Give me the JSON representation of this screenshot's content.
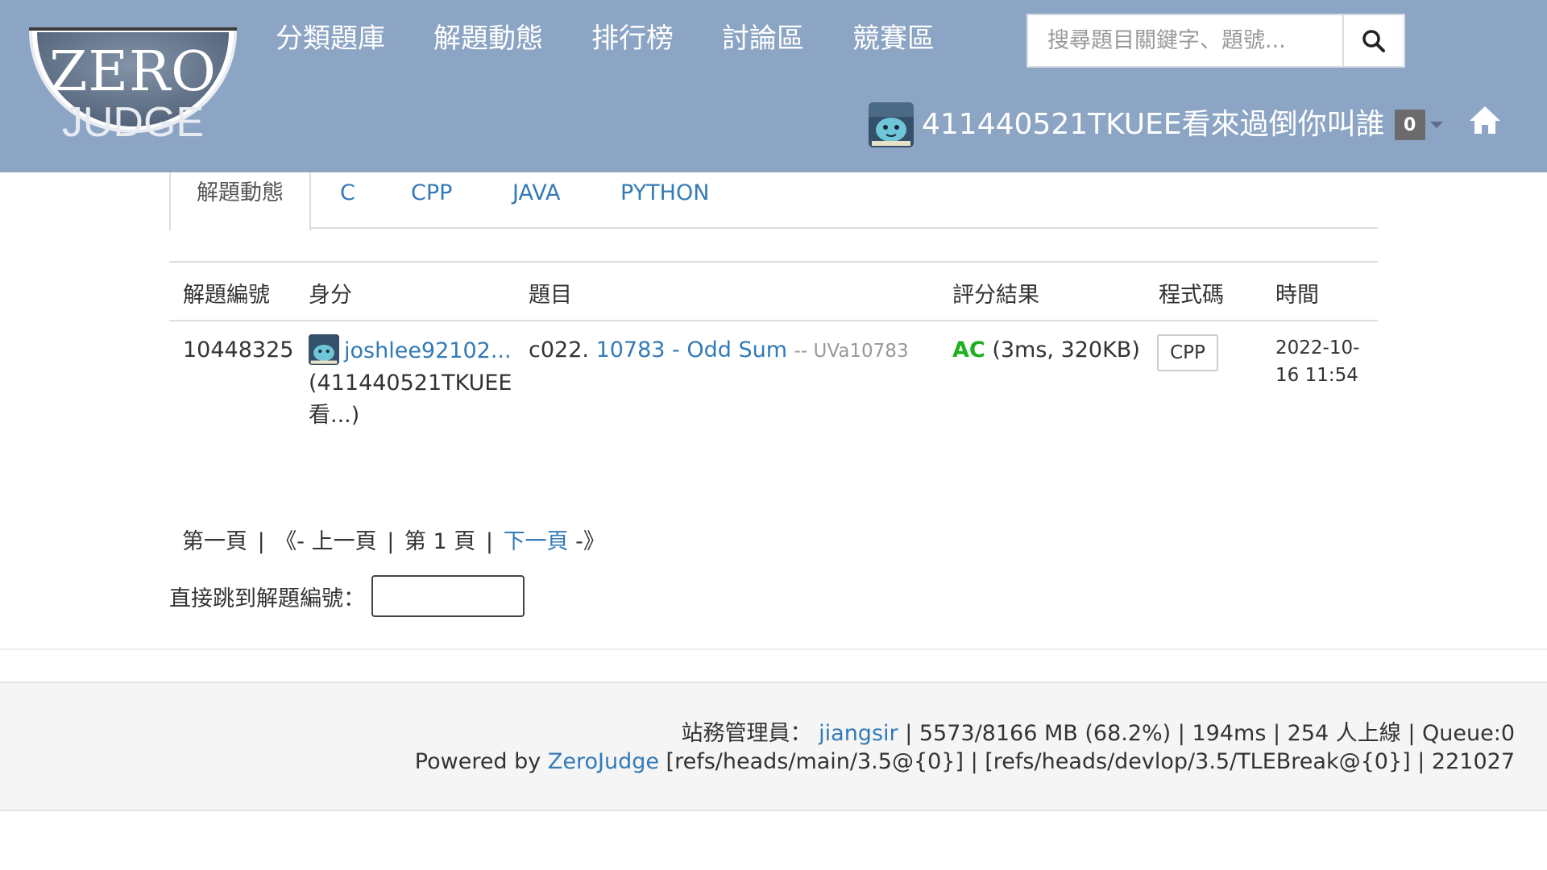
{
  "logo": {
    "line1": "ZERO",
    "line2": "JUDGE"
  },
  "nav": {
    "items": [
      "分類題庫",
      "解題動態",
      "排行榜",
      "討論區",
      "競賽區"
    ]
  },
  "search": {
    "placeholder": "搜尋題目關鍵字、題號..."
  },
  "user": {
    "name": "411440521TKUEE看來過倒你叫誰",
    "badge": "0"
  },
  "tabs": {
    "active": "解題動態",
    "items": [
      "C",
      "CPP",
      "JAVA",
      "PYTHON"
    ]
  },
  "table": {
    "headers": {
      "id": "解題編號",
      "identity": "身分",
      "problem": "題目",
      "result": "評分結果",
      "code": "程式碼",
      "time": "時間"
    },
    "rows": [
      {
        "id": "10448325",
        "username": "joshlee92102...",
        "identity_line1": "(411440521TKUEE",
        "identity_line2": "看...)",
        "problem_code": "c022.",
        "problem_title": "10783 - Odd Sum",
        "problem_source": "-- UVa10783",
        "result_status": "AC",
        "result_detail": "(3ms, 320KB)",
        "code_lang": "CPP",
        "time_line1": "2022-10-",
        "time_line2": "16 11:54"
      }
    ]
  },
  "pager": {
    "first": "第一頁",
    "prev": "《- 上一頁",
    "current": "第 1 頁",
    "next": "下一頁",
    "next_suffix": " -》",
    "separator": "|"
  },
  "jump": {
    "label": "直接跳到解題編號："
  },
  "footer": {
    "admin_label": "站務管理員：",
    "admin_name": "jiangsir",
    "stats": " | 5573/8166 MB (68.2%) | 194ms | 254 人上線 | Queue:0",
    "powered_by": "Powered by ",
    "brand": "ZeroJudge",
    "refs": " [refs/heads/main/3.5@{0}] | [refs/heads/devlop/3.5/TLEBreak@{0}] | 221027"
  },
  "colors": {
    "navbar": "#8da5c4",
    "link": "#337ab7",
    "accepted": "#1fb01f",
    "footer_bg": "#f5f5f5"
  },
  "icons": [
    "search-icon",
    "home-icon",
    "caret-down-icon",
    "avatar"
  ]
}
